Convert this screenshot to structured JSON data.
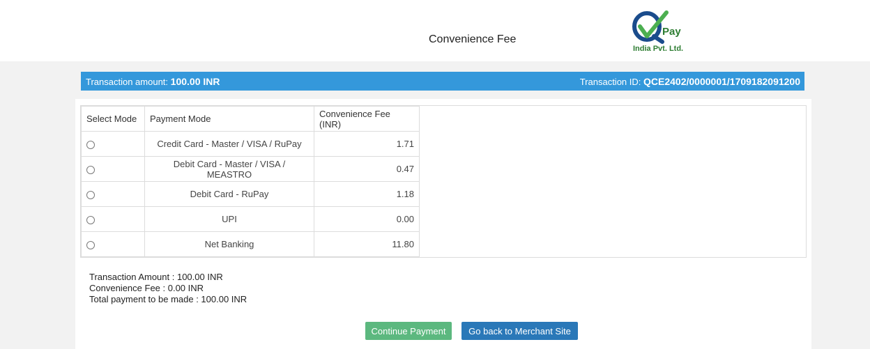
{
  "header": {
    "title": "Convenience Fee",
    "logo_text": "Pay",
    "logo_subtitle": "India Pvt. Ltd.",
    "logo_color": "#2e7d32"
  },
  "transaction": {
    "amount_label": "Transaction amount:",
    "amount_value": "100.00 INR",
    "id_label": "Transaction ID:",
    "id_value": "QCE2402/0000001/1709182091200",
    "bar_color": "#3498db"
  },
  "table": {
    "headers": [
      "Select Mode",
      "Payment Mode",
      "Convenience Fee (INR)"
    ],
    "rows": [
      {
        "mode": "Credit Card - Master / VISA / RuPay",
        "fee": "1.71"
      },
      {
        "mode": "Debit Card - Master / VISA / MEASTRO",
        "fee": "0.47"
      },
      {
        "mode": "Debit Card - RuPay",
        "fee": "1.18"
      },
      {
        "mode": "UPI",
        "fee": "0.00"
      },
      {
        "mode": "Net Banking",
        "fee": "11.80"
      }
    ]
  },
  "summary": {
    "transaction_amount": "Transaction Amount : 100.00 INR",
    "convenience_fee": "Convenience Fee : 0.00 INR",
    "total_payment": "Total payment to be made : 100.00 INR"
  },
  "buttons": {
    "continue_label": "Continue Payment",
    "continue_color": "#5cb87f",
    "back_label": "Go back to Merchant Site",
    "back_color": "#2a78b8"
  }
}
